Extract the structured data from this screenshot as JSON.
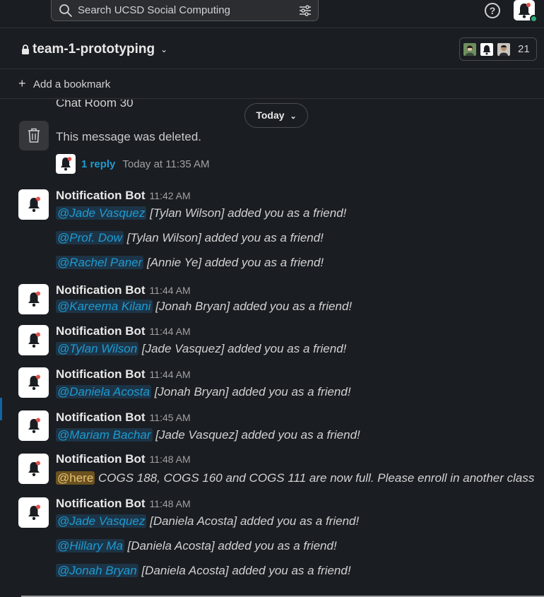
{
  "search": {
    "placeholder": "Search UCSD Social Computing"
  },
  "help": {
    "label": "?"
  },
  "channel": {
    "name": "team-1-prototyping",
    "member_count": "21"
  },
  "bookmark": {
    "plus": "+",
    "label": "Add a bookmark"
  },
  "divider": {
    "label": "Today",
    "caret": "⌄"
  },
  "cut_message": "Chat Room 30",
  "deleted_message": "This message was deleted.",
  "thread": {
    "replies": "1 reply",
    "time": "Today at 11:35 AM"
  },
  "messages": [
    {
      "sender": "Notification Bot",
      "time": "11:42 AM",
      "lines": [
        {
          "mention": "@Jade Vasquez",
          "text": " [Tylan Wilson] added you as a friend!"
        },
        {
          "mention": "@Prof. Dow",
          "text": " [Tylan Wilson] added you as a friend!"
        },
        {
          "mention": "@Rachel Paner",
          "text": " [Annie Ye] added you as a friend!"
        }
      ]
    },
    {
      "sender": "Notification Bot",
      "time": "11:44 AM",
      "lines": [
        {
          "mention": "@Kareema Kilani",
          "text": " [Jonah Bryan] added you as a friend!"
        }
      ]
    },
    {
      "sender": "Notification Bot",
      "time": "11:44 AM",
      "lines": [
        {
          "mention": "@Tylan Wilson",
          "text": " [Jade Vasquez] added you as a friend!"
        }
      ]
    },
    {
      "sender": "Notification Bot",
      "time": "11:44 AM",
      "lines": [
        {
          "mention": "@Daniela Acosta",
          "text": " [Jonah Bryan] added you as a friend!"
        }
      ]
    },
    {
      "sender": "Notification Bot",
      "time": "11:45 AM",
      "lines": [
        {
          "mention": "@Mariam Bachar",
          "text": " [Jade Vasquez] added you as a friend!"
        }
      ]
    },
    {
      "sender": "Notification Bot",
      "time": "11:48 AM",
      "lines": [
        {
          "mention": "@here",
          "text": " COGS 188, COGS 160 and COGS 111 are now full. Please enroll in another class"
        }
      ]
    },
    {
      "sender": "Notification Bot",
      "time": "11:48 AM",
      "lines": [
        {
          "mention": "@Jade Vasquez",
          "text": " [Daniela Acosta] added you as a friend!"
        },
        {
          "mention": "@Hillary Ma",
          "text": " [Daniela Acosta] added you as a friend!"
        },
        {
          "mention": "@Jonah Bryan",
          "text": " [Daniela Acosta] added you as a friend!"
        }
      ]
    }
  ],
  "colors": {
    "background": "#1a1d21",
    "mention": "#1d9bd1",
    "here_mention": "#e8c170",
    "presence": "#2bac76"
  }
}
